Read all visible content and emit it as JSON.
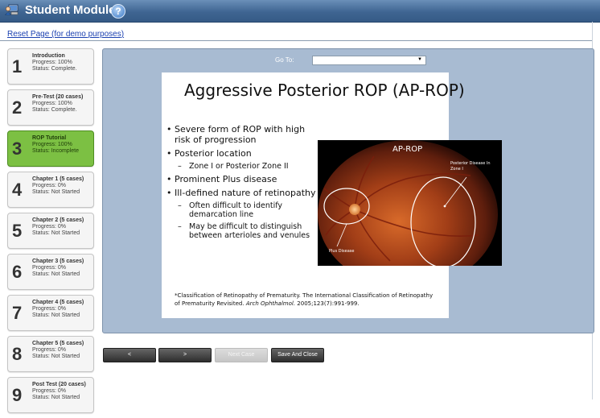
{
  "header": {
    "title": "Student Module",
    "help_label": "?"
  },
  "reset_link": "Reset Page (for demo purposes)",
  "sidebar": {
    "items": [
      {
        "number": "1",
        "name": "Introduction",
        "progress": "Progress: 100%",
        "status": "Status: Complete.",
        "active": false
      },
      {
        "number": "2",
        "name": "Pre-Test (20 cases)",
        "progress": "Progress: 100%",
        "status": "Status: Complete.",
        "active": false
      },
      {
        "number": "3",
        "name": "ROP Tutorial",
        "progress": "Progress: 100%",
        "status": "Status: Incomplete",
        "active": true
      },
      {
        "number": "4",
        "name": "Chapter 1 (5 cases)",
        "progress": "Progress: 0%",
        "status": "Status: Not Started",
        "active": false
      },
      {
        "number": "5",
        "name": "Chapter 2 (5 cases)",
        "progress": "Progress: 0%",
        "status": "Status: Not Started",
        "active": false
      },
      {
        "number": "6",
        "name": "Chapter 3 (5 cases)",
        "progress": "Progress: 0%",
        "status": "Status: Not Started",
        "active": false
      },
      {
        "number": "7",
        "name": "Chapter 4 (5 cases)",
        "progress": "Progress: 0%",
        "status": "Status: Not Started",
        "active": false
      },
      {
        "number": "8",
        "name": "Chapter 5 (5 cases)",
        "progress": "Progress: 0%",
        "status": "Status: Not Started",
        "active": false
      },
      {
        "number": "9",
        "name": "Post Test (20 cases)",
        "progress": "Progress: 0%",
        "status": "Status: Not Started",
        "active": false
      }
    ]
  },
  "goto": {
    "label": "Go To:",
    "value": ""
  },
  "slide": {
    "title": "Aggressive Posterior ROP (AP-ROP)",
    "bullets": [
      {
        "level": 1,
        "text": "Severe form of ROP with high risk of progression"
      },
      {
        "level": 1,
        "text": "Posterior location"
      },
      {
        "level": 2,
        "text": "Zone I or Posterior Zone II"
      },
      {
        "level": 1,
        "text": "Prominent Plus disease"
      },
      {
        "level": 1,
        "text": "Ill-defined nature of retinopathy"
      },
      {
        "level": 2,
        "text": "Often difficult to identify demarcation line"
      },
      {
        "level": 2,
        "text": "May be difficult to distinguish between arterioles and venules"
      }
    ],
    "image": {
      "caption": "AP-ROP",
      "label_right": "Posterior Disease In Zone I",
      "label_left": "Plus Disease"
    },
    "footnote_pre": "*Classification of Retinopathy of Prematurity. The International Classification of Retinopathy of Prematurity Revisited. ",
    "footnote_journal": "Arch Ophthalmol.",
    "footnote_post": " 2005;123(7):991-999."
  },
  "buttons": {
    "prev": "<",
    "next": ">",
    "next_case": "Next Case",
    "save_close": "Save And Close"
  },
  "colors": {
    "active_step": "#7cc043",
    "stage_bg": "#a8bbd2",
    "titlebar": "#3f6592"
  }
}
